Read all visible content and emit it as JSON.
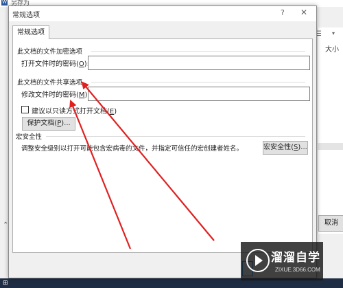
{
  "background": {
    "window_title": "另存为",
    "app_icon_letter": "W",
    "size_column": "大小",
    "cancel_label": "取消"
  },
  "dialog": {
    "title": "常规选项",
    "help_glyph": "?",
    "close_glyph": "✕",
    "tab_label": "常规选项",
    "encryption_heading": "此文档的文件加密选项",
    "open_password_label": "打开文件时的密码(O):",
    "sharing_heading": "此文档的文件共享选项",
    "modify_password_label": "修改文件时的密码(M):",
    "readonly_checkbox_label": "建议以只读方式打开文档(E)",
    "protect_button_label": "保护文档(P)...",
    "macro_heading": "宏安全性",
    "macro_description": "调整安全级别以打开可能包含宏病毒的文件，并指定可信任的宏创建者姓名。",
    "macro_button_label": "宏安全性(S)...",
    "readonly_checked": false
  },
  "watermark": {
    "text": "溜溜自学",
    "url": "ZIXUE.3D66.COM"
  },
  "colors": {
    "arrow": "#e02020",
    "accent": "#0078d7"
  }
}
